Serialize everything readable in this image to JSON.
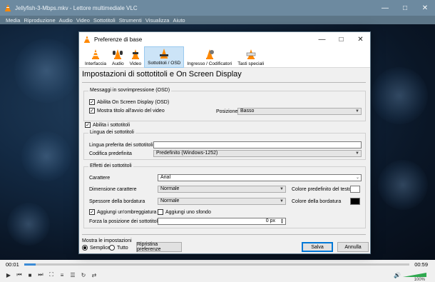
{
  "vlc": {
    "title": "Jellyfish-3-Mbps.mkv - Lettore multimediale VLC",
    "menu": [
      "Media",
      "Riproduzione",
      "Audio",
      "Video",
      "Sottotitoli",
      "Strumenti",
      "Visualizza",
      "Aiuto"
    ],
    "time_current": "00:01",
    "time_total": "00:59",
    "seek_progress": 0.03,
    "volume_label": "100%"
  },
  "dialog": {
    "title": "Preferenze di base",
    "tabs": [
      "Interfaccia",
      "Audio",
      "Video",
      "Sottotitoli / OSD",
      "Ingresso / Codificatori",
      "Tasti speciali"
    ],
    "active_tab": "Sottotitoli / OSD",
    "heading": "Impostazioni di sottotitoli e On Screen Display",
    "osd": {
      "title": "Messaggi in sovrimpressione (OSD)",
      "enable_osd": "Abilita On Screen Display (OSD)",
      "show_title": "Mostra titolo all'avvio del video",
      "position_label": "Posizione",
      "position_value": "Basso"
    },
    "enable_subs": "Abilita i sottotitoli",
    "language": {
      "title": "Lingua dei sottotitoli",
      "preferred_label": "Lingua preferita dei sottotitoli",
      "preferred_value": "",
      "encoding_label": "Codifica predefinita",
      "encoding_value": "Predefinito (Windows-1252)"
    },
    "effects": {
      "title": "Effetti dei sottotitoli",
      "font_label": "Carattere",
      "font_value": "Arial",
      "size_label": "Dimensione carattere",
      "size_value": "Normale",
      "text_color_label": "Colore predefinito del testo",
      "text_color": "#ffffff",
      "outline_label": "Spessore della bordatura",
      "outline_value": "Normale",
      "outline_color_label": "Colore della bordatura",
      "outline_color": "#000000",
      "shadow_label": "Aggiungi un'ombreggiatura",
      "background_label": "Aggiungi uno sfondo",
      "force_pos_label": "Forza la posizione dei sottotitoli",
      "force_pos_value": "0 px"
    },
    "show_settings_label": "Mostra le impostazioni",
    "simple_label": "Semplice",
    "all_label": "Tutto",
    "reset_button": "Ripristina preferenze",
    "save_button": "Salva",
    "cancel_button": "Annulla"
  }
}
